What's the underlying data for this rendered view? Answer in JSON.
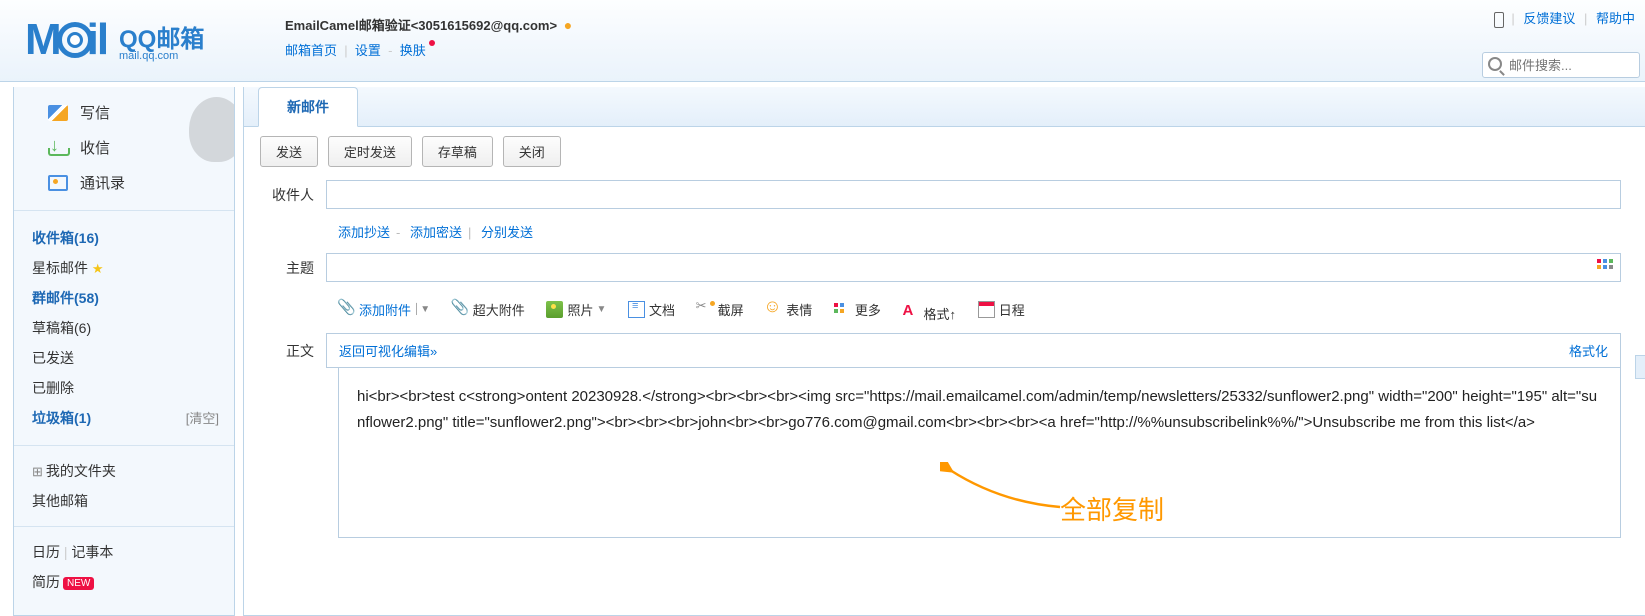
{
  "header": {
    "user_line": "EmailCamel邮箱验证<3051615692@qq.com>",
    "home": "邮箱首页",
    "settings": "设置",
    "skin": "换肤",
    "feedback": "反馈建议",
    "help": "帮助中",
    "search_placeholder": "邮件搜索...",
    "logo_text": "QQ邮箱",
    "logo_sub": "mail.qq.com"
  },
  "sidebar": {
    "compose": "写信",
    "receive": "收信",
    "contacts": "通讯录",
    "inbox": "收件箱(16)",
    "starred": "星标邮件",
    "group": "群邮件(58)",
    "drafts": "草稿箱(6)",
    "sent": "已发送",
    "deleted": "已删除",
    "junk": "垃圾箱(1)",
    "clear": "[清空]",
    "myfolders": "我的文件夹",
    "other": "其他邮箱",
    "calendar": "日历",
    "notes": "记事本",
    "resume": "简历",
    "resume_badge": "NEW"
  },
  "compose": {
    "tab": "新邮件",
    "send": "发送",
    "timed": "定时发送",
    "draft": "存草稿",
    "close": "关闭",
    "to_label": "收件人",
    "add_cc": "添加抄送",
    "add_bcc": "添加密送",
    "sep_send": "分别发送",
    "subject_label": "主题",
    "body_label": "正文",
    "return_visual": "返回可视化编辑»",
    "format": "格式化",
    "attachments": {
      "add": "添加附件",
      "big": "超大附件",
      "photo": "照片",
      "doc": "文档",
      "screenshot": "截屏",
      "emoji": "表情",
      "more": "更多",
      "fmt": "格式↑",
      "schedule": "日程"
    },
    "body_text": "hi<br><br>test c<strong>ontent 20230928.</strong><br><br><br><img src=\"https://mail.emailcamel.com/admin/temp/newsletters/25332/sunflower2.png\" width=\"200\" height=\"195\" alt=\"sunflower2.png\" title=\"sunflower2.png\"><br><br><br>john<br><br>go776.com@gmail.com<br><br><br><a href=\"http://%%unsubscribelink%%/\">Unsubscribe me from this list</a>"
  },
  "annotation": "全部复制"
}
